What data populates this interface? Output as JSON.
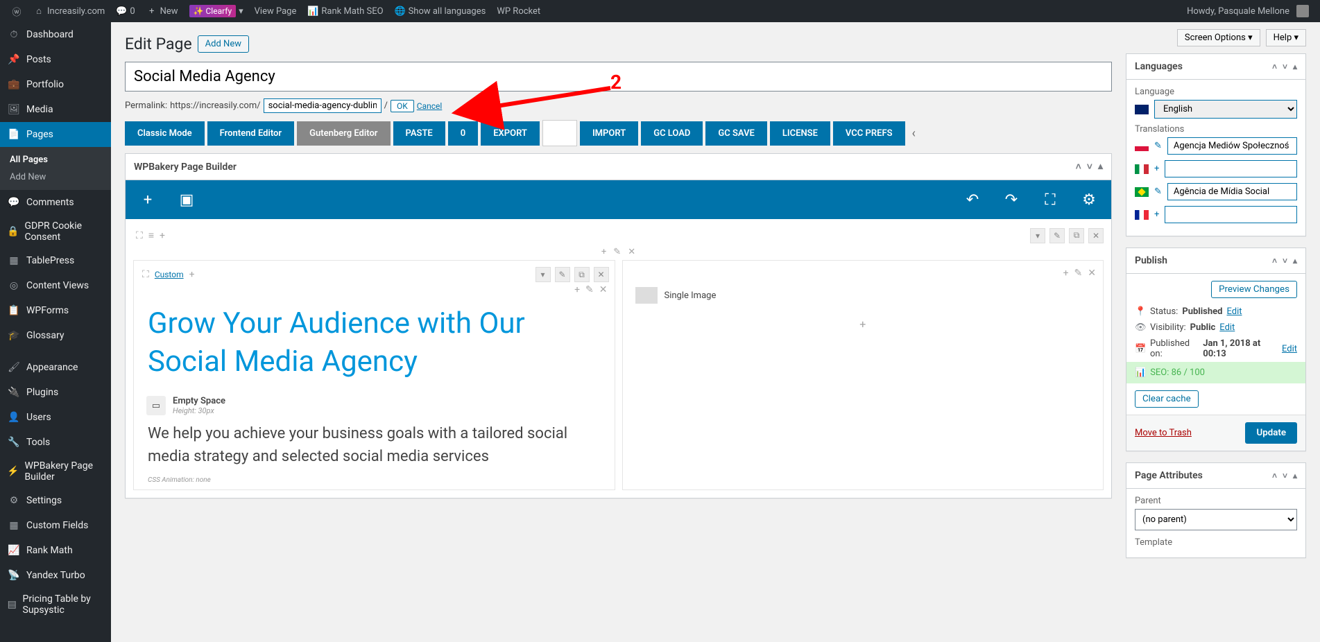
{
  "toolbar": {
    "site_name": "Increasily.com",
    "comments": "0",
    "new": "New",
    "clearfy": "Clearfy",
    "view_page": "View Page",
    "rank_math": "Rank Math SEO",
    "show_langs": "Show all languages",
    "wp_rocket": "WP Rocket",
    "howdy": "Howdy, Pasquale Mellone"
  },
  "sidebar": {
    "dashboard": "Dashboard",
    "posts": "Posts",
    "portfolio": "Portfolio",
    "media": "Media",
    "pages": "Pages",
    "all_pages": "All Pages",
    "add_new": "Add New",
    "comments": "Comments",
    "gdpr": "GDPR Cookie Consent",
    "tablepress": "TablePress",
    "content_views": "Content Views",
    "wpforms": "WPForms",
    "glossary": "Glossary",
    "appearance": "Appearance",
    "plugins": "Plugins",
    "users": "Users",
    "tools": "Tools",
    "wpbakery": "WPBakery Page Builder",
    "settings": "Settings",
    "custom_fields": "Custom Fields",
    "rank_math": "Rank Math",
    "yandex": "Yandex Turbo",
    "pricing_table": "Pricing Table by Supsystic"
  },
  "page": {
    "heading": "Edit Page",
    "add_new": "Add New",
    "title": "Social Media Agency",
    "permalink_label": "Permalink:",
    "permalink_base": "https://increasily.com/",
    "slug": "social-media-agency-dublin",
    "ok": "OK",
    "cancel": "Cancel",
    "arrow_label": "2"
  },
  "buttons": {
    "classic": "Classic Mode",
    "frontend": "Frontend Editor",
    "gutenberg": "Gutenberg Editor",
    "paste": "PASTE",
    "zero": "0",
    "export": "EXPORT",
    "import": "IMPORT",
    "gc_load": "GC LOAD",
    "gc_save": "GC SAVE",
    "license": "LICENSE",
    "vcc_prefs": "VCC PREFS"
  },
  "vc": {
    "title": "WPBakery Page Builder",
    "custom": "Custom",
    "heading": "Grow Your Audience with Our Social Media Agency",
    "empty_space": "Empty Space",
    "empty_space_sub": "Height: 30px",
    "text_block": "We help you achieve your business goals with a tailored social media strategy and selected social media services",
    "anim": "CSS Animation: none",
    "single_image": "Single Image"
  },
  "top_buttons": {
    "screen_options": "Screen Options",
    "help": "Help"
  },
  "meta": {
    "languages": {
      "title": "Languages",
      "language_label": "Language",
      "current": "English",
      "translations_label": "Translations",
      "pl": "Agencja Mediów Społecznoś",
      "it": "",
      "br": "Agência de Mídia Social",
      "fr": ""
    },
    "publish": {
      "title": "Publish",
      "preview": "Preview Changes",
      "status_label": "Status:",
      "status": "Published",
      "visibility_label": "Visibility:",
      "visibility": "Public",
      "published_label": "Published on:",
      "published": "Jan 1, 2018 at 00:13",
      "edit": "Edit",
      "seo": "SEO: 86 / 100",
      "clear_cache": "Clear cache",
      "trash": "Move to Trash",
      "update": "Update"
    },
    "attributes": {
      "title": "Page Attributes",
      "parent_label": "Parent",
      "parent": "(no parent)",
      "template_label": "Template"
    }
  }
}
